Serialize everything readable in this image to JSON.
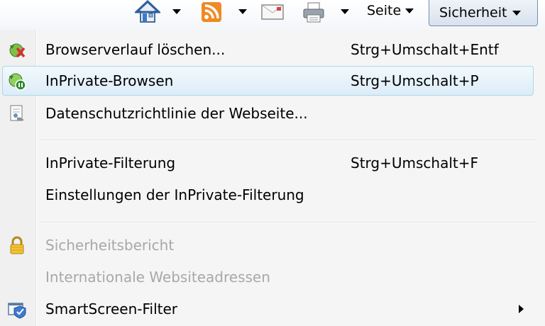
{
  "toolbar": {
    "seite_label": "Seite",
    "sicherheit_label": "Sicherheit"
  },
  "menu": {
    "items": [
      {
        "label": "Browserverlauf löschen...",
        "shortcut": "Strg+Umschalt+Entf",
        "icon": "clear-history-icon",
        "enabled": true
      },
      {
        "label": "InPrivate-Browsen",
        "shortcut": "Strg+Umschalt+P",
        "icon": "inprivate-icon",
        "enabled": true,
        "highlighted": true
      },
      {
        "label": "Datenschutzrichtlinie der Webseite...",
        "shortcut": "",
        "icon": "privacy-policy-icon",
        "enabled": true
      },
      {
        "label": "InPrivate-Filterung",
        "shortcut": "Strg+Umschalt+F",
        "icon": "",
        "enabled": true
      },
      {
        "label": "Einstellungen der InPrivate-Filterung",
        "shortcut": "",
        "icon": "",
        "enabled": true
      },
      {
        "label": "Sicherheitsbericht",
        "shortcut": "",
        "icon": "lock-icon",
        "enabled": false
      },
      {
        "label": "Internationale Websiteadressen",
        "shortcut": "",
        "icon": "",
        "enabled": false
      },
      {
        "label": "SmartScreen-Filter",
        "shortcut": "",
        "icon": "smartscreen-icon",
        "enabled": true,
        "submenu": true
      }
    ]
  },
  "colors": {
    "highlight_border": "#a8d8eb",
    "disabled_text": "#a8a8a8",
    "rss_orange": "#f08a24"
  }
}
